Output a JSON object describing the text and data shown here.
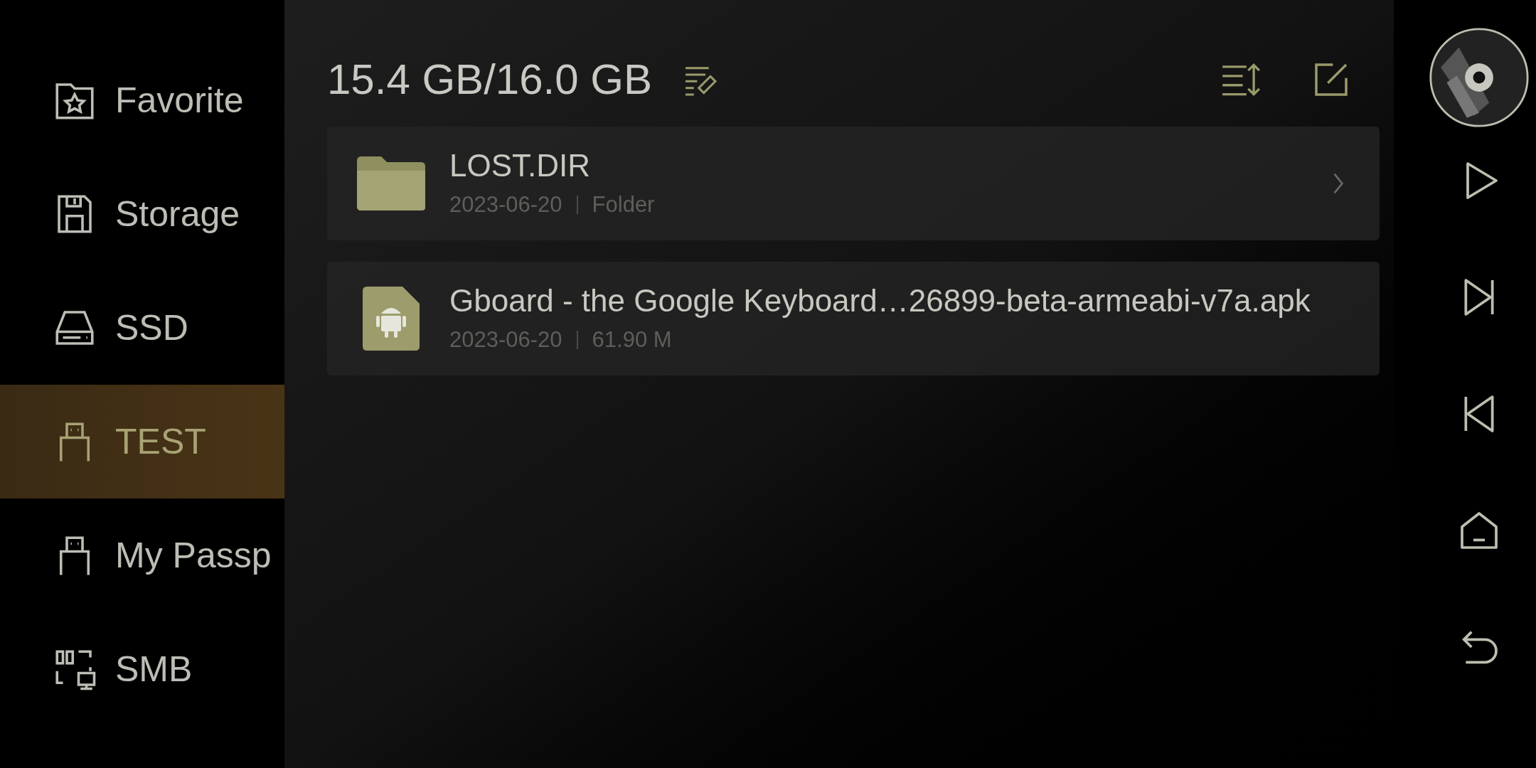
{
  "sidebar": {
    "items": [
      {
        "label": "Favorite",
        "kind": "favorite",
        "selected": false
      },
      {
        "label": "Storage",
        "kind": "storage",
        "selected": false
      },
      {
        "label": "SSD",
        "kind": "ssd",
        "selected": false
      },
      {
        "label": "TEST",
        "kind": "usb",
        "selected": true
      },
      {
        "label": "My Passp",
        "kind": "usb",
        "selected": false
      },
      {
        "label": "SMB",
        "kind": "smb",
        "selected": false
      }
    ]
  },
  "header": {
    "title": "15.4 GB/16.0 GB"
  },
  "files": [
    {
      "name": "LOST.DIR",
      "date": "2023-06-20",
      "detail": "Folder",
      "kind": "folder"
    },
    {
      "name": "Gboard - the Google Keyboard…26899-beta-armeabi-v7a.apk",
      "date": "2023-06-20",
      "detail": "61.90 M",
      "kind": "apk"
    }
  ],
  "player_controls": [
    {
      "kind": "play"
    },
    {
      "kind": "next"
    },
    {
      "kind": "previous"
    },
    {
      "kind": "home"
    },
    {
      "kind": "back"
    }
  ]
}
